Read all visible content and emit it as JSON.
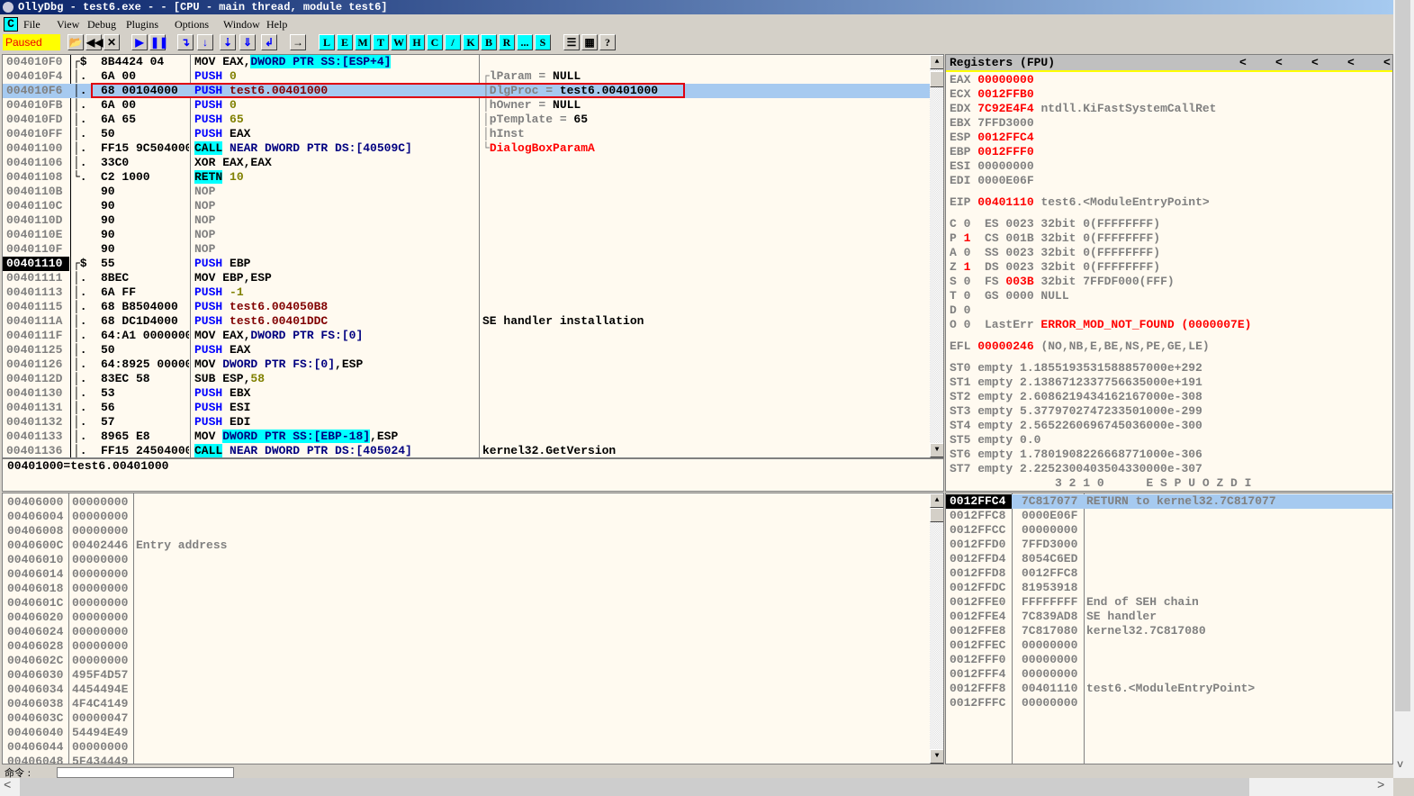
{
  "window": {
    "title": "OllyDbg - test6.exe - - [CPU - main thread, module test6]"
  },
  "menu": {
    "cpu_icon": "C",
    "items": [
      "File",
      "View",
      "Debug",
      "Plugins",
      "Options",
      "Window",
      "Help"
    ]
  },
  "toolbar": {
    "status": "Paused",
    "buttons": [
      "open",
      "restart",
      "close",
      "run",
      "pause",
      "step-into",
      "step-over",
      "trace-into",
      "trace-over",
      "execute-till-return",
      "go-to-user-code"
    ],
    "window_buttons": [
      "L",
      "E",
      "M",
      "T",
      "W",
      "H",
      "C",
      "/",
      "K",
      "B",
      "R",
      "...",
      "S"
    ],
    "extra": [
      "list",
      "colors",
      "?"
    ]
  },
  "disasm": {
    "rows": [
      {
        "addr": "004010F0",
        "j": "┌$",
        "bytes": "8B4424 04",
        "ins": [
          [
            "MOV EAX,",
            "k"
          ],
          [
            "DWORD PTR SS:[ESP+4]",
            "hl"
          ]
        ],
        "cmt": []
      },
      {
        "addr": "004010F4",
        "j": "│.",
        "bytes": "6A 00",
        "ins": [
          [
            "PUSH ",
            "kw"
          ],
          [
            "0",
            "imm"
          ]
        ],
        "cmt": [
          [
            "┌lParam = ",
            "g"
          ],
          [
            "NULL",
            "blk"
          ]
        ]
      },
      {
        "addr": "004010F6",
        "j": "│.",
        "bytes": "68 00104000",
        "ins": [
          [
            "PUSH ",
            "kw"
          ],
          [
            "test6.00401000",
            "ref"
          ]
        ],
        "cmt": [
          [
            "│DlgProc = ",
            "g"
          ],
          [
            "test6.00401000",
            "blk"
          ]
        ],
        "sel": true
      },
      {
        "addr": "004010FB",
        "j": "│.",
        "bytes": "6A 00",
        "ins": [
          [
            "PUSH ",
            "kw"
          ],
          [
            "0",
            "imm"
          ]
        ],
        "cmt": [
          [
            "│hOwner = ",
            "g"
          ],
          [
            "NULL",
            "blk"
          ]
        ]
      },
      {
        "addr": "004010FD",
        "j": "│.",
        "bytes": "6A 65",
        "ins": [
          [
            "PUSH ",
            "kw"
          ],
          [
            "65",
            "imm"
          ]
        ],
        "cmt": [
          [
            "│pTemplate = ",
            "g"
          ],
          [
            "65",
            "blk"
          ]
        ]
      },
      {
        "addr": "004010FF",
        "j": "│.",
        "bytes": "50",
        "ins": [
          [
            "PUSH ",
            "kw"
          ],
          [
            "EAX",
            "k"
          ]
        ],
        "cmt": [
          [
            "│hInst",
            "g"
          ]
        ]
      },
      {
        "addr": "00401100",
        "j": "│.",
        "bytes": "FF15 9C504000",
        "ins": [
          [
            "CALL",
            "call"
          ],
          [
            " NEAR DWORD PTR DS:[40509C]",
            "mem"
          ]
        ],
        "cmt": [
          [
            "└",
            "g"
          ],
          [
            "DialogBoxParamA",
            "red"
          ]
        ]
      },
      {
        "addr": "00401106",
        "j": "│.",
        "bytes": "33C0",
        "ins": [
          [
            "XOR EAX,EAX",
            "k"
          ]
        ],
        "cmt": []
      },
      {
        "addr": "00401108",
        "j": "└.",
        "bytes": "C2 1000",
        "ins": [
          [
            "RETN",
            "call"
          ],
          [
            " 10",
            "imm"
          ]
        ],
        "cmt": []
      },
      {
        "addr": "0040110B",
        "j": "",
        "bytes": "90",
        "ins": [
          [
            "NOP",
            "nop"
          ]
        ],
        "cmt": []
      },
      {
        "addr": "0040110C",
        "j": "",
        "bytes": "90",
        "ins": [
          [
            "NOP",
            "nop"
          ]
        ],
        "cmt": []
      },
      {
        "addr": "0040110D",
        "j": "",
        "bytes": "90",
        "ins": [
          [
            "NOP",
            "nop"
          ]
        ],
        "cmt": []
      },
      {
        "addr": "0040110E",
        "j": "",
        "bytes": "90",
        "ins": [
          [
            "NOP",
            "nop"
          ]
        ],
        "cmt": []
      },
      {
        "addr": "0040110F",
        "j": "",
        "bytes": "90",
        "ins": [
          [
            "NOP",
            "nop"
          ]
        ],
        "cmt": []
      },
      {
        "addr": "00401110",
        "j": "┌$",
        "bytes": "55",
        "ins": [
          [
            "PUSH ",
            "kw"
          ],
          [
            "EBP",
            "k"
          ]
        ],
        "cmt": [],
        "eip": true
      },
      {
        "addr": "00401111",
        "j": "│.",
        "bytes": "8BEC",
        "ins": [
          [
            "MOV EBP,ESP",
            "k"
          ]
        ],
        "cmt": []
      },
      {
        "addr": "00401113",
        "j": "│.",
        "bytes": "6A FF",
        "ins": [
          [
            "PUSH ",
            "kw"
          ],
          [
            "-1",
            "imm"
          ]
        ],
        "cmt": []
      },
      {
        "addr": "00401115",
        "j": "│.",
        "bytes": "68 B8504000",
        "ins": [
          [
            "PUSH ",
            "kw"
          ],
          [
            "test6.004050B8",
            "ref"
          ]
        ],
        "cmt": []
      },
      {
        "addr": "0040111A",
        "j": "│.",
        "bytes": "68 DC1D4000",
        "ins": [
          [
            "PUSH ",
            "kw"
          ],
          [
            "test6.00401DDC",
            "ref"
          ]
        ],
        "cmt": [
          [
            "SE handler installation",
            "blk"
          ]
        ]
      },
      {
        "addr": "0040111F",
        "j": "│.",
        "bytes": "64:A1 00000000",
        "ins": [
          [
            "MOV EAX,",
            "k"
          ],
          [
            "DWORD PTR FS:[0]",
            "mem"
          ]
        ],
        "cmt": []
      },
      {
        "addr": "00401125",
        "j": "│.",
        "bytes": "50",
        "ins": [
          [
            "PUSH ",
            "kw"
          ],
          [
            "EAX",
            "k"
          ]
        ],
        "cmt": []
      },
      {
        "addr": "00401126",
        "j": "│.",
        "bytes": "64:8925 00000000",
        "ins": [
          [
            "MOV ",
            "k"
          ],
          [
            "DWORD PTR FS:[0]",
            "mem"
          ],
          [
            ",ESP",
            "k"
          ]
        ],
        "cmt": []
      },
      {
        "addr": "0040112D",
        "j": "│.",
        "bytes": "83EC 58",
        "ins": [
          [
            "SUB ESP,",
            "k"
          ],
          [
            "58",
            "imm"
          ]
        ],
        "cmt": []
      },
      {
        "addr": "00401130",
        "j": "│.",
        "bytes": "53",
        "ins": [
          [
            "PUSH ",
            "kw"
          ],
          [
            "EBX",
            "k"
          ]
        ],
        "cmt": []
      },
      {
        "addr": "00401131",
        "j": "│.",
        "bytes": "56",
        "ins": [
          [
            "PUSH ",
            "kw"
          ],
          [
            "ESI",
            "k"
          ]
        ],
        "cmt": []
      },
      {
        "addr": "00401132",
        "j": "│.",
        "bytes": "57",
        "ins": [
          [
            "PUSH ",
            "kw"
          ],
          [
            "EDI",
            "k"
          ]
        ],
        "cmt": []
      },
      {
        "addr": "00401133",
        "j": "│.",
        "bytes": "8965 E8",
        "ins": [
          [
            "MOV ",
            "k"
          ],
          [
            "DWORD PTR SS:[EBP-18]",
            "hl"
          ],
          [
            ",ESP",
            "k"
          ]
        ],
        "cmt": []
      },
      {
        "addr": "00401136",
        "j": "│.",
        "bytes": "FF15 24504000",
        "ins": [
          [
            "CALL",
            "call"
          ],
          [
            " NEAR DWORD PTR DS:[405024]",
            "mem"
          ]
        ],
        "cmt": [
          [
            "kernel32.GetVersion",
            "blk"
          ]
        ]
      }
    ]
  },
  "info_line": "00401000=test6.00401000",
  "registers": {
    "title": "Registers (FPU)",
    "nav": [
      "<",
      "<",
      "<",
      "<",
      "<"
    ],
    "lines": [
      [
        [
          "EAX ",
          "g"
        ],
        [
          "00000000",
          "red"
        ]
      ],
      [
        [
          "ECX ",
          "g"
        ],
        [
          "0012FFB0",
          "red"
        ]
      ],
      [
        [
          "EDX ",
          "g"
        ],
        [
          "7C92E4F4",
          "red"
        ],
        [
          " ntdll.KiFastSystemCallRet",
          "g"
        ]
      ],
      [
        [
          "EBX 7FFD3000",
          "g"
        ]
      ],
      [
        [
          "ESP ",
          "g"
        ],
        [
          "0012FFC4",
          "red"
        ]
      ],
      [
        [
          "EBP ",
          "g"
        ],
        [
          "0012FFF0",
          "red"
        ]
      ],
      [
        [
          "ESI 00000000",
          "g"
        ]
      ],
      [
        [
          "EDI 0000E06F",
          "g"
        ]
      ],
      [],
      [
        [
          "EIP ",
          "g"
        ],
        [
          "00401110",
          "red"
        ],
        [
          " test6.<ModuleEntryPoint>",
          "g"
        ]
      ],
      [],
      [
        [
          "C 0  ES 0023 32bit 0(FFFFFFFF)",
          "g"
        ]
      ],
      [
        [
          "P ",
          "g"
        ],
        [
          "1",
          "red"
        ],
        [
          "  CS 001B 32bit 0(FFFFFFFF)",
          "g"
        ]
      ],
      [
        [
          "A 0  SS 0023 32bit 0(FFFFFFFF)",
          "g"
        ]
      ],
      [
        [
          "Z ",
          "g"
        ],
        [
          "1",
          "red"
        ],
        [
          "  DS 0023 32bit 0(FFFFFFFF)",
          "g"
        ]
      ],
      [
        [
          "S 0  FS ",
          "g"
        ],
        [
          "003B",
          "red"
        ],
        [
          " 32bit 7FFDF000(FFF)",
          "g"
        ]
      ],
      [
        [
          "T 0  GS 0000 NULL",
          "g"
        ]
      ],
      [
        [
          "D 0",
          "g"
        ]
      ],
      [
        [
          "O 0  LastErr ",
          "g"
        ],
        [
          "ERROR_MOD_NOT_FOUND (0000007E)",
          "red"
        ]
      ],
      [],
      [
        [
          "EFL ",
          "g"
        ],
        [
          "00000246",
          "red"
        ],
        [
          " (NO,NB,E,BE,NS,PE,GE,LE)",
          "g"
        ]
      ],
      [],
      [
        [
          "ST0 empty 1.1855193531588857000e+292",
          "g"
        ]
      ],
      [
        [
          "ST1 empty 2.1386712337756635000e+191",
          "g"
        ]
      ],
      [
        [
          "ST2 empty 2.6086219434162167000e-308",
          "g"
        ]
      ],
      [
        [
          "ST3 empty 5.3779702747233501000e-299",
          "g"
        ]
      ],
      [
        [
          "ST4 empty 2.5652260696745036000e-300",
          "g"
        ]
      ],
      [
        [
          "ST5 empty 0.0",
          "g"
        ]
      ],
      [
        [
          "ST6 empty 1.7801908226668771000e-306",
          "g"
        ]
      ],
      [
        [
          "ST7 empty 2.2252300403504330000e-307",
          "g"
        ]
      ],
      [
        [
          "               3 2 1 0      E S P U O Z D I",
          "g"
        ]
      ]
    ]
  },
  "dump": {
    "rows": [
      [
        "00406000",
        "00000000",
        ""
      ],
      [
        "00406004",
        "00000000",
        ""
      ],
      [
        "00406008",
        "00000000",
        ""
      ],
      [
        "0040600C",
        "00402446",
        "Entry address"
      ],
      [
        "00406010",
        "00000000",
        ""
      ],
      [
        "00406014",
        "00000000",
        ""
      ],
      [
        "00406018",
        "00000000",
        ""
      ],
      [
        "0040601C",
        "00000000",
        ""
      ],
      [
        "00406020",
        "00000000",
        ""
      ],
      [
        "00406024",
        "00000000",
        ""
      ],
      [
        "00406028",
        "00000000",
        ""
      ],
      [
        "0040602C",
        "00000000",
        ""
      ],
      [
        "00406030",
        "495F4D57",
        ""
      ],
      [
        "00406034",
        "4454494E",
        ""
      ],
      [
        "00406038",
        "4F4C4149",
        ""
      ],
      [
        "0040603C",
        "00000047",
        ""
      ],
      [
        "00406040",
        "54494E49",
        ""
      ],
      [
        "00406044",
        "00000000",
        ""
      ],
      [
        "00406048",
        "5F434449",
        ""
      ]
    ]
  },
  "stack": {
    "rows": [
      [
        "0012FFC4",
        "7C817077",
        "RETURN to kernel32.7C817077"
      ],
      [
        "0012FFC8",
        "0000E06F",
        ""
      ],
      [
        "0012FFCC",
        "00000000",
        ""
      ],
      [
        "0012FFD0",
        "7FFD3000",
        ""
      ],
      [
        "0012FFD4",
        "8054C6ED",
        ""
      ],
      [
        "0012FFD8",
        "0012FFC8",
        ""
      ],
      [
        "0012FFDC",
        "81953918",
        ""
      ],
      [
        "0012FFE0",
        "FFFFFFFF",
        "End of SEH chain"
      ],
      [
        "0012FFE4",
        "7C839AD8",
        "SE handler"
      ],
      [
        "0012FFE8",
        "7C817080",
        "kernel32.7C817080"
      ],
      [
        "0012FFEC",
        "00000000",
        ""
      ],
      [
        "0012FFF0",
        "00000000",
        ""
      ],
      [
        "0012FFF4",
        "00000000",
        ""
      ],
      [
        "0012FFF8",
        "00401110",
        "test6.<ModuleEntryPoint>"
      ],
      [
        "0012FFFC",
        "00000000",
        ""
      ]
    ]
  },
  "command": {
    "label": "命令 :",
    "value": ""
  },
  "colors": {
    "selection": "#a6caf0",
    "highlight": "#00ffff",
    "status_bg": "#ffff00",
    "annotation_box": "#e00000"
  }
}
